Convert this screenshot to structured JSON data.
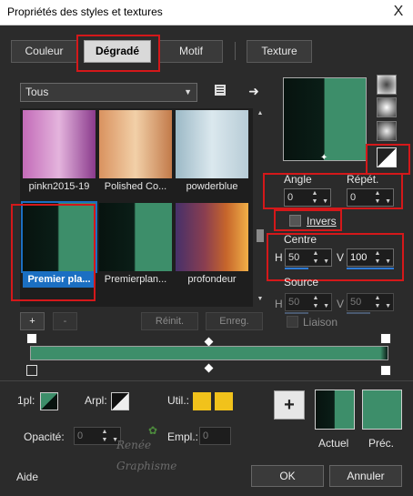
{
  "window": {
    "title": "Propriétés des styles et textures",
    "close_label": "X"
  },
  "tabs": [
    {
      "label": "Couleur",
      "active": false
    },
    {
      "label": "Dégradé",
      "active": true
    },
    {
      "label": "Motif",
      "active": false
    },
    {
      "label": "Texture",
      "active": false
    }
  ],
  "filter": {
    "selected": "Tous"
  },
  "gradients": [
    {
      "label": "pinkn2015-19",
      "colors": [
        "#c36bb8",
        "#e4b4dd",
        "#8a3a8c"
      ]
    },
    {
      "label": "Polished Co...",
      "colors": [
        "#d9925f",
        "#f2d0a8",
        "#c27a4a"
      ]
    },
    {
      "label": "powderblue",
      "colors": [
        "#9cb9c6",
        "#dbe8ee",
        "#b7ccd6"
      ]
    },
    {
      "label": "Premier pla...",
      "colors": [
        "#07130f",
        "#3d8e6a"
      ],
      "selected": true
    },
    {
      "label": "Premierplan...",
      "colors": [
        "#07130f",
        "#3d8e6a"
      ]
    },
    {
      "label": "profondeur",
      "colors": [
        "#46306a",
        "#c7662b",
        "#f0b048"
      ]
    }
  ],
  "gallery_buttons": {
    "add": "+",
    "remove": "-",
    "reset": "Réinit.",
    "save": "Enreg."
  },
  "angle": {
    "label": "Angle",
    "value": "0"
  },
  "repeat": {
    "label": "Répét.",
    "value": "0"
  },
  "invert": {
    "label": "Invers"
  },
  "center": {
    "label": "Centre",
    "h_label": "H",
    "h_value": "50",
    "v_label": "V",
    "v_value": "100"
  },
  "source": {
    "label": "Source",
    "h_label": "H",
    "h_value": "50",
    "v_label": "V",
    "v_value": "50"
  },
  "link": {
    "label": "Liaison"
  },
  "stops": {
    "fg_label": "1pl:",
    "bg_label": "Arpl:",
    "user_label": "Util.:",
    "opacity_label": "Opacité:",
    "opacity_value": "0",
    "location_label": "Empl.:",
    "location_value": "0"
  },
  "preview_samples": {
    "add": "+",
    "current_label": "Actuel",
    "previous_label": "Préc."
  },
  "footer": {
    "help": "Aide",
    "ok": "OK",
    "cancel": "Annuler"
  },
  "colors": {
    "accent": "#1b6fc2",
    "highlight": "#d4181a",
    "gradient_dark": "#07130f",
    "gradient_green": "#3d8e6a",
    "user_yellow": "#f1c21b"
  }
}
